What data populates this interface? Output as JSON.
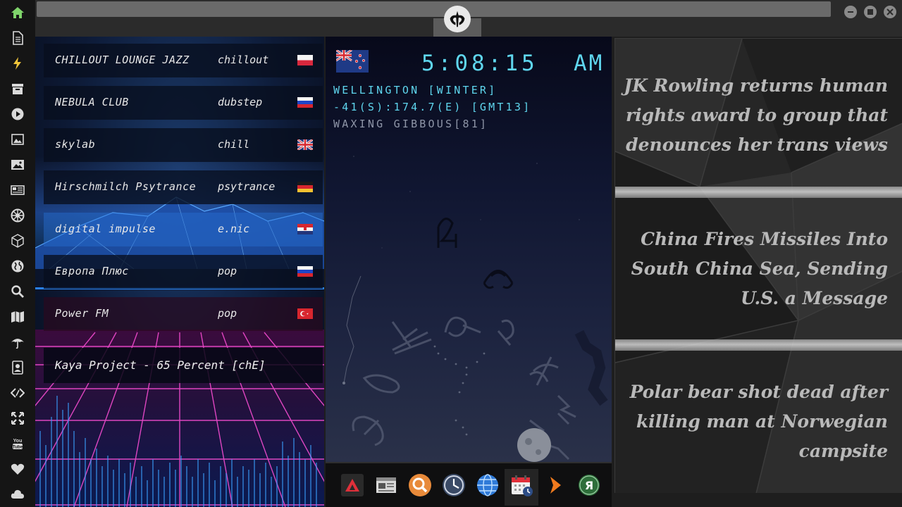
{
  "sidebar": {
    "items": [
      {
        "icon": "home-icon"
      },
      {
        "icon": "document-icon"
      },
      {
        "icon": "lightning-icon"
      },
      {
        "icon": "archive-icon"
      },
      {
        "icon": "play-circle-icon"
      },
      {
        "icon": "photo-frame-icon"
      },
      {
        "icon": "image-icon"
      },
      {
        "icon": "newspaper-icon"
      },
      {
        "icon": "empire-icon"
      },
      {
        "icon": "cube-icon"
      },
      {
        "icon": "globe-icon"
      },
      {
        "icon": "search-icon"
      },
      {
        "icon": "map-icon"
      },
      {
        "icon": "umbrella-icon"
      },
      {
        "icon": "contact-card-icon"
      },
      {
        "icon": "code-icon"
      },
      {
        "icon": "expand-icon"
      },
      {
        "icon": "youtube-icon"
      },
      {
        "icon": "heart-icon"
      },
      {
        "icon": "cloud-icon"
      }
    ]
  },
  "radio": {
    "stations": [
      {
        "name": "CHILLOUT LOUNGE JAZZ",
        "genre": "chillout",
        "flag": "poland"
      },
      {
        "name": "NEBULA CLUB",
        "genre": "dubstep",
        "flag": "russia"
      },
      {
        "name": "skylab",
        "genre": "chill",
        "flag": "united-kingdom"
      },
      {
        "name": "Hirschmilch Psytrance",
        "genre": "psytrance",
        "flag": "germany"
      },
      {
        "name": "digital impulse",
        "genre": "e.nic",
        "flag": "croatia"
      },
      {
        "name": "Европа Плюс",
        "genre": "pop",
        "flag": "russia"
      },
      {
        "name": "Power FM",
        "genre": "pop",
        "flag": "turkey"
      }
    ],
    "now_playing": "Kaya Project - 65 Percent [chE]"
  },
  "clock": {
    "time": "5:08:15",
    "ampm": "AM",
    "city": "WELLINGTON [WINTER]",
    "coords": "-41(S):174.7(E) [GMT13]",
    "moon": "WAXING GIBBOUS[81]",
    "flag": "new-zealand"
  },
  "dock": {
    "apps": [
      {
        "icon": "red-triangle-app-icon"
      },
      {
        "icon": "calendar-news-icon"
      },
      {
        "icon": "magnifier-app-icon"
      },
      {
        "icon": "clock-app-icon"
      },
      {
        "icon": "globe-app-icon"
      },
      {
        "icon": "calendar-clock-app-icon"
      },
      {
        "icon": "play-arrow-app-icon"
      },
      {
        "icon": "yandex-app-icon"
      }
    ]
  },
  "news": {
    "headlines": [
      "JK Rowling returns human rights award to group that denounces her trans views",
      "China Fires Missiles Into South China Sea, Sending U.S. a Message",
      "Polar bear shot dead after killing man at Norwegian campsite"
    ]
  },
  "colors": {
    "clock_cyan": "#5fd6ee",
    "headline_gray": "#b9b9b9",
    "sidebar_bg": "#151515"
  }
}
